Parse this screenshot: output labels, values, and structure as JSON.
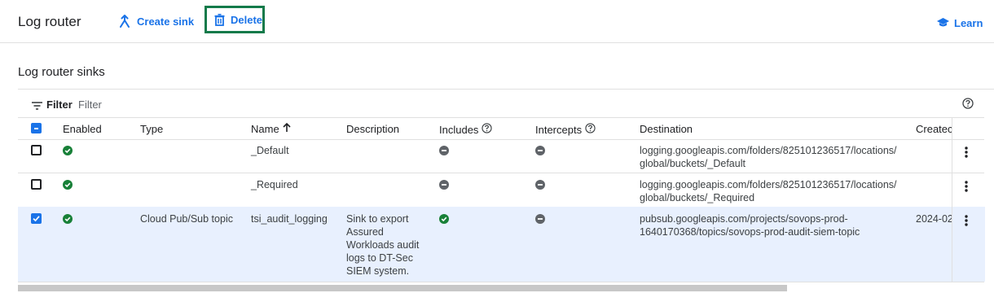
{
  "toolbar": {
    "title": "Log router",
    "create_label": "Create sink",
    "delete_label": "Delete",
    "learn_label": "Learn"
  },
  "section": {
    "title": "Log router sinks"
  },
  "filter": {
    "label": "Filter",
    "placeholder": "Filter"
  },
  "table": {
    "headers": {
      "enabled": "Enabled",
      "type": "Type",
      "name": "Name",
      "description": "Description",
      "includes": "Includes",
      "intercepts": "Intercepts",
      "destination": "Destination",
      "created": "Createc"
    },
    "rows": [
      {
        "checked": false,
        "enabled": "enabled",
        "type": "",
        "name": "_Default",
        "description": [],
        "includes": "none",
        "intercepts": "none",
        "destination": [
          "logging.googleapis.com/folders/825101236517/locations/",
          "global/buckets/_Default"
        ],
        "created": ""
      },
      {
        "checked": false,
        "enabled": "enabled",
        "type": "",
        "name": "_Required",
        "description": [],
        "includes": "none",
        "intercepts": "none",
        "destination": [
          "logging.googleapis.com/folders/825101236517/locations/",
          "global/buckets/_Required"
        ],
        "created": ""
      },
      {
        "checked": true,
        "enabled": "enabled",
        "type": "Cloud Pub/Sub topic",
        "name": "tsi_audit_logging",
        "description": [
          "Sink to export",
          "Assured",
          "Workloads audit",
          "logs to DT-Sec",
          "SIEM system."
        ],
        "includes": "enabled",
        "intercepts": "none",
        "destination": [
          "pubsub.googleapis.com/projects/sovops-prod-",
          "1640170368/topics/sovops-prod-audit-siem-topic"
        ],
        "created": "2024-02"
      }
    ]
  },
  "colors": {
    "accent": "#1a73e8",
    "enabled_green": "#188038",
    "none_gray": "#5f6368",
    "selected_row": "#e8f0fe",
    "highlight_border": "#137a4a"
  }
}
